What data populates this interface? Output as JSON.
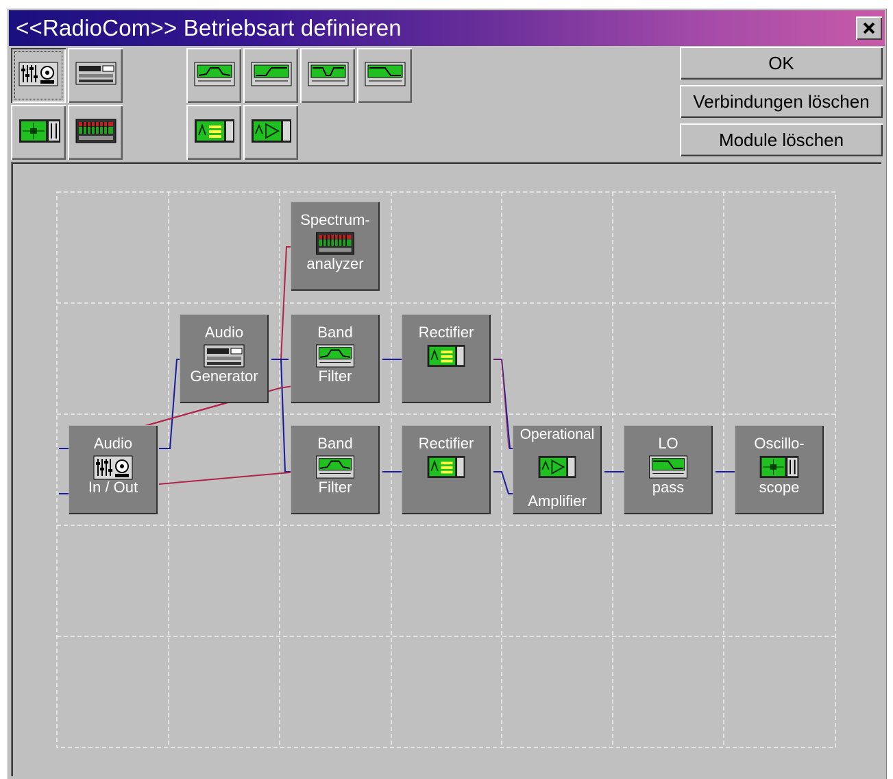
{
  "window": {
    "title": "<<RadioCom>> Betriebsart definieren"
  },
  "toolbar": {
    "tools": [
      {
        "name": "tool-audio-in-out",
        "icon": "audio-in-out-icon"
      },
      {
        "name": "tool-audio-generator",
        "icon": "audio-generator-icon"
      },
      {
        "name": "tool-oscilloscope",
        "icon": "oscilloscope-icon"
      },
      {
        "name": "tool-spectrum-analyzer",
        "icon": "spectrum-analyzer-icon"
      },
      {
        "name": "tool-band-filter",
        "icon": "band-filter-icon"
      },
      {
        "name": "tool-high-pass",
        "icon": "high-pass-icon"
      },
      {
        "name": "tool-band-stop",
        "icon": "band-stop-icon"
      },
      {
        "name": "tool-low-pass",
        "icon": "low-pass-icon"
      },
      {
        "name": "tool-rectifier",
        "icon": "rectifier-icon"
      },
      {
        "name": "tool-operational-amplifier",
        "icon": "operational-amplifier-icon"
      }
    ]
  },
  "buttons": {
    "ok": "OK",
    "delete_connections": "Verbindungen löschen",
    "delete_modules": "Module löschen"
  },
  "modules": {
    "spectrum": {
      "top": "Spectrum-",
      "bottom": "analyzer"
    },
    "audio_gen": {
      "top": "Audio",
      "bottom": "Generator"
    },
    "band_filter_1": {
      "top": "Band",
      "bottom": "Filter"
    },
    "rectifier_1": {
      "top": "Rectifier",
      "bottom": ""
    },
    "audio_io": {
      "top": "Audio",
      "bottom": "In / Out"
    },
    "band_filter_2": {
      "top": "Band",
      "bottom": "Filter"
    },
    "rectifier_2": {
      "top": "Rectifier",
      "bottom": ""
    },
    "op_amp": {
      "top": "Operational",
      "bottom": "Amplifier"
    },
    "low_pass": {
      "top": "LO",
      "bottom": "pass"
    },
    "oscilloscope": {
      "top": "Oscillo-",
      "bottom": "scope"
    }
  },
  "colors": {
    "title_gradient_start": "#1a1080",
    "title_gradient_end": "#c85aa8",
    "face": "#c0c0c0",
    "module": "#808080",
    "wire_primary": "#1a1a9a",
    "wire_secondary": "#b0244c",
    "icon_screen": "#20c020"
  }
}
